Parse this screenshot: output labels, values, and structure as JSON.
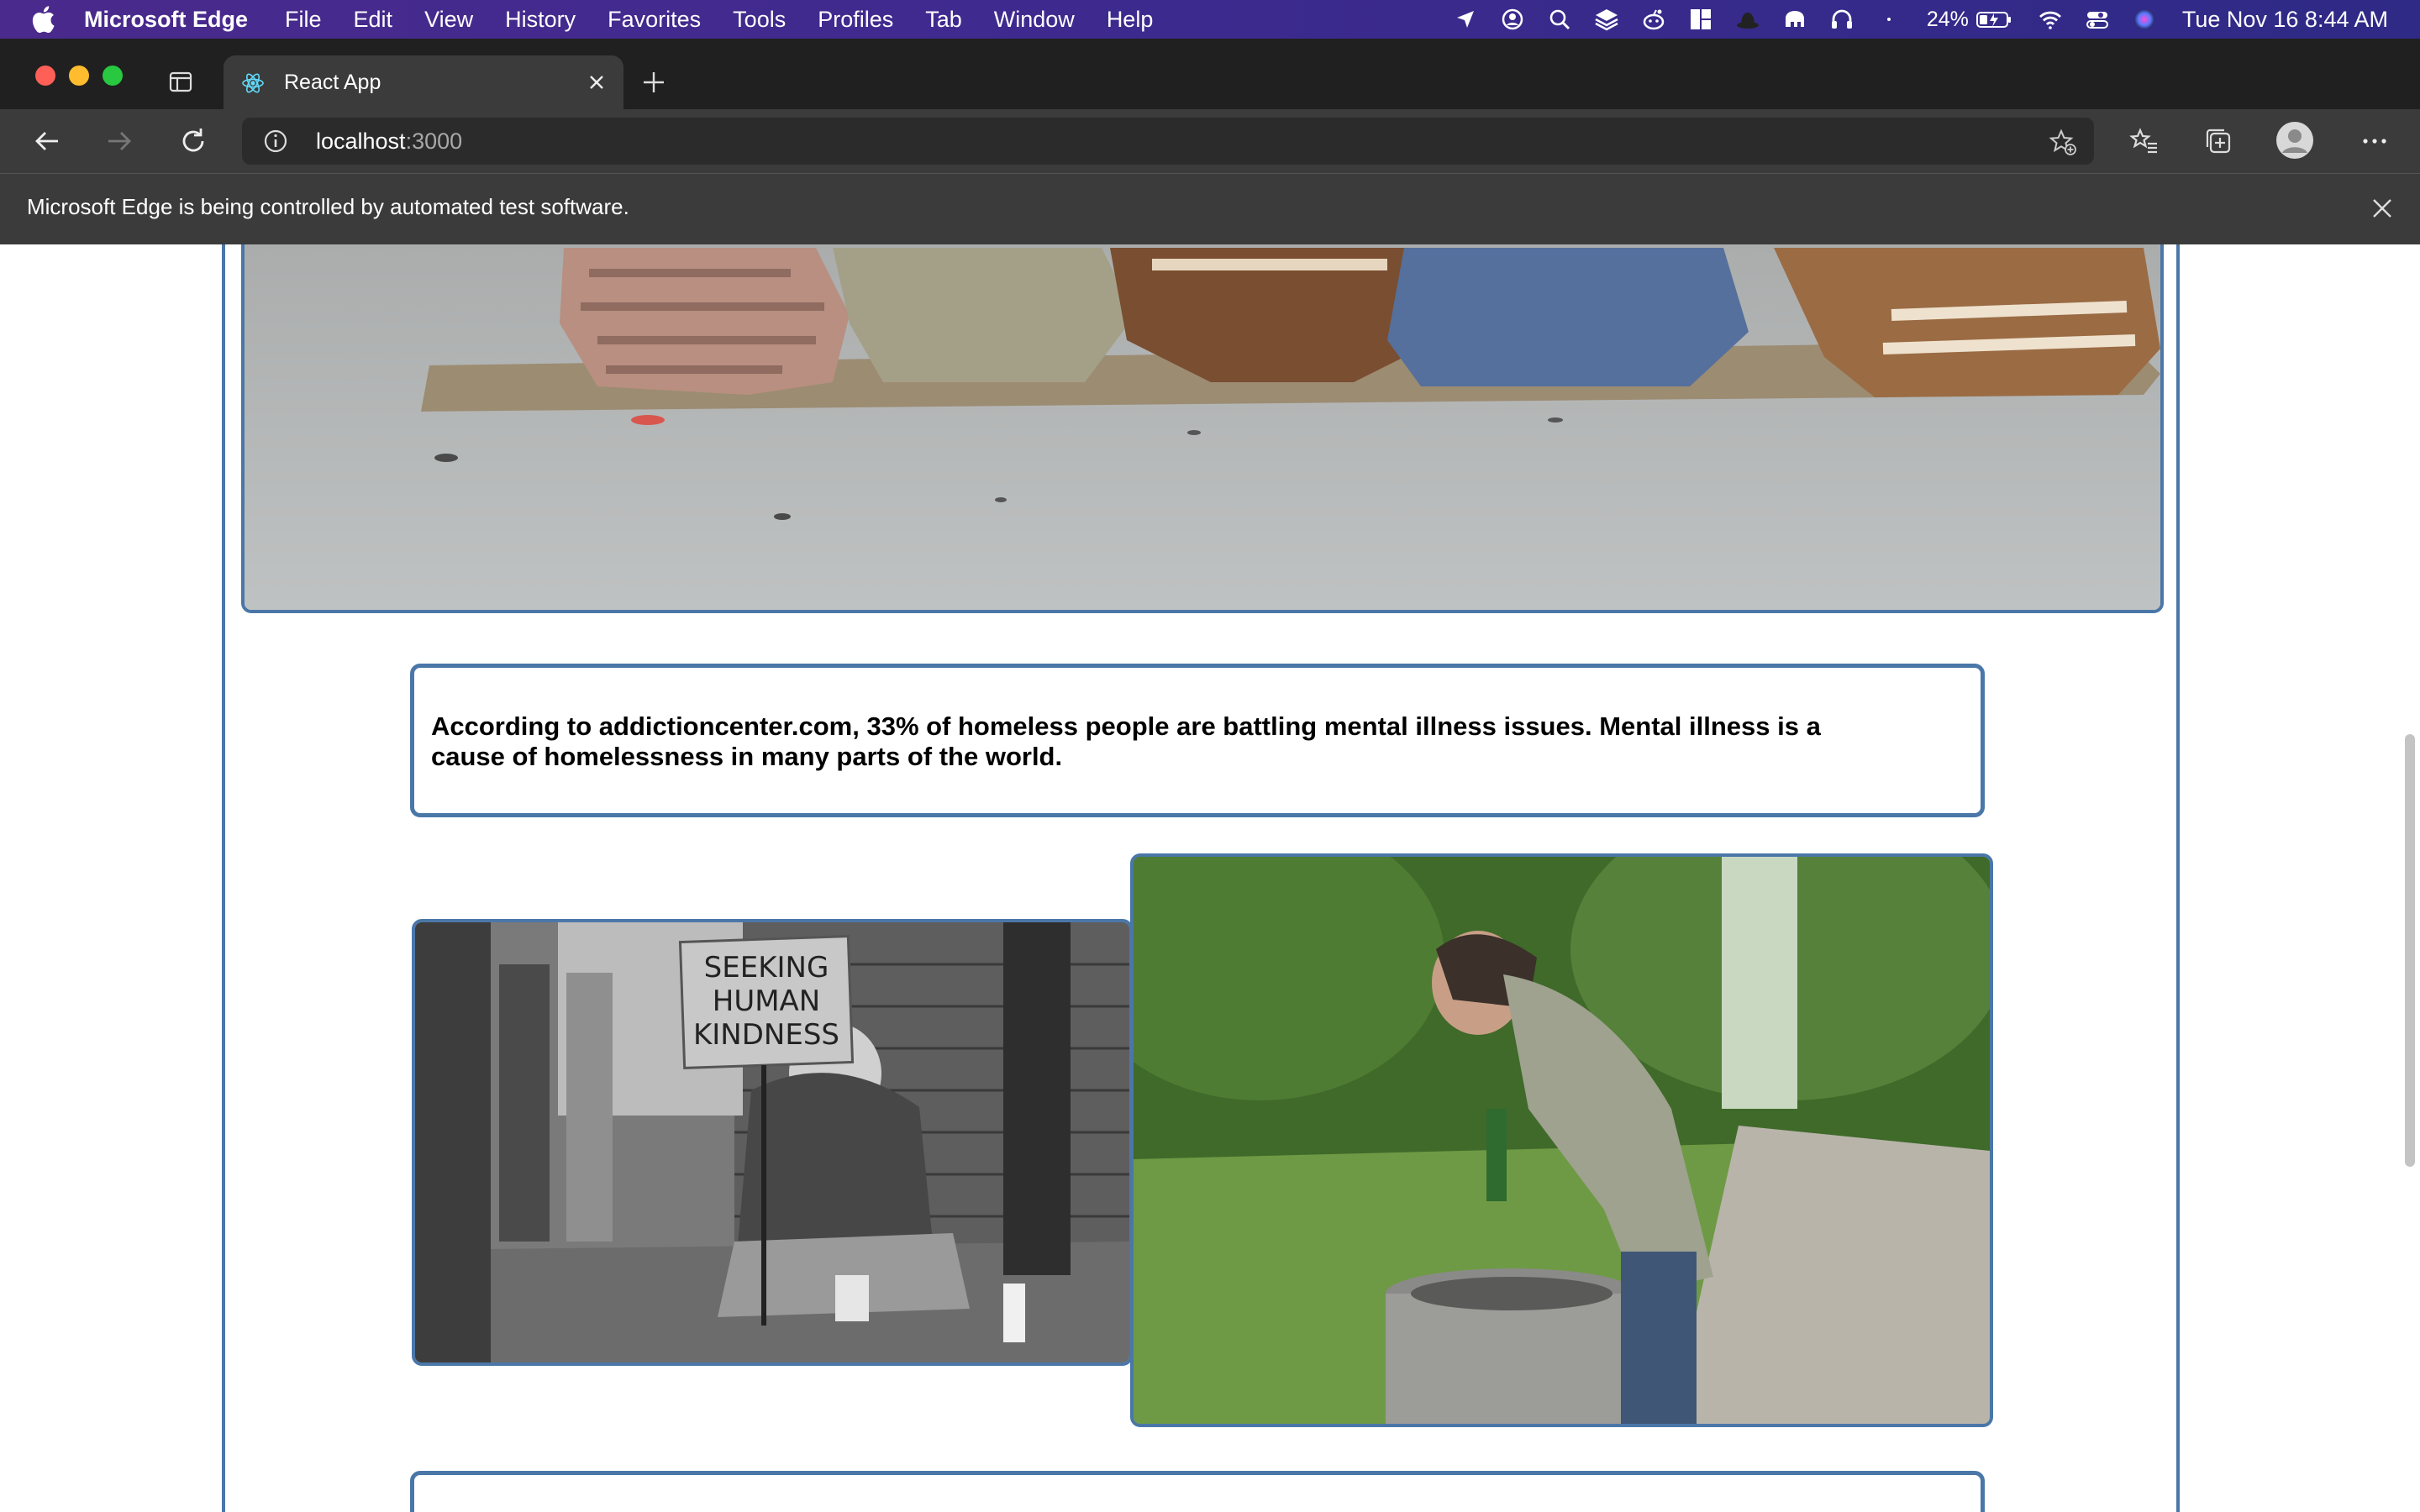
{
  "menubar": {
    "app_name": "Microsoft Edge",
    "items": [
      "File",
      "Edit",
      "View",
      "History",
      "Favorites",
      "Tools",
      "Profiles",
      "Tab",
      "Window",
      "Help"
    ],
    "battery": "24%",
    "clock": "Tue Nov 16  8:44 AM"
  },
  "browser": {
    "tab_title": "React App",
    "url_host": "localhost",
    "url_port": ":3000",
    "infobar_message": "Microsoft Edge is being controlled by automated test software."
  },
  "page": {
    "stat_text": "According to addictioncenter.com, 33% of homeless people are battling mental illness issues. Mental illness is a cause of homelessness in many parts of the world.",
    "left_photo_sign": [
      "SEEKING",
      "HUMAN",
      "KINDNESS"
    ]
  },
  "colors": {
    "accent_border": "#4a77a8"
  }
}
